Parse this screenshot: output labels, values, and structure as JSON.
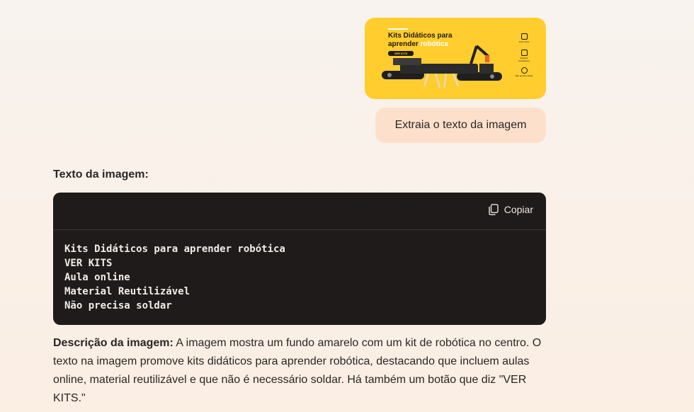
{
  "attachment": {
    "title_line1": "Kits Didáticos para",
    "title_line2_a": "aprender ",
    "title_line2_b": "robótica",
    "button": "VER KITS",
    "features": [
      "Aula online",
      "Material Reutilizável",
      "Não precisa soldar"
    ],
    "background_color": "#ffcd2e"
  },
  "user_message": "Extraia o texto da imagem",
  "response": {
    "heading": "Texto da imagem:",
    "copy_label": "Copiar",
    "code_lines": [
      "Kits Didáticos para aprender robótica",
      "VER KITS",
      "Aula online",
      "Material Reutilizável",
      "Não precisa soldar"
    ],
    "description_label": "Descrição da imagem:",
    "description_text": " A imagem mostra um fundo amarelo com um kit de robótica no centro. O texto na imagem promove kits didáticos para aprender robótica, destacando que incluem aulas online, material reutilizável e que não é necessário soldar. Há também um botão que diz \"VER KITS.\""
  }
}
